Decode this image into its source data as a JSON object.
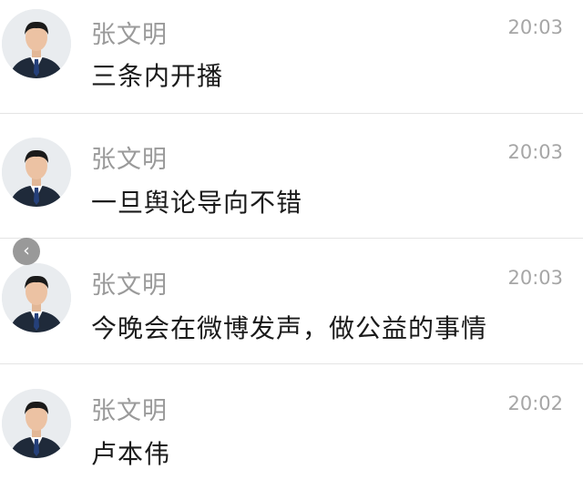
{
  "messages": [
    {
      "sender": "张文明",
      "time": "20:03",
      "text": "三条内开播"
    },
    {
      "sender": "张文明",
      "time": "20:03",
      "text": "一旦舆论导向不错"
    },
    {
      "sender": "张文明",
      "time": "20:03",
      "text": "今晚会在微博发声，做公益的事情"
    },
    {
      "sender": "张文明",
      "time": "20:02",
      "text": "卢本伟"
    }
  ],
  "back_button": {
    "icon": "chevron-left-icon",
    "glyph": "‹"
  }
}
